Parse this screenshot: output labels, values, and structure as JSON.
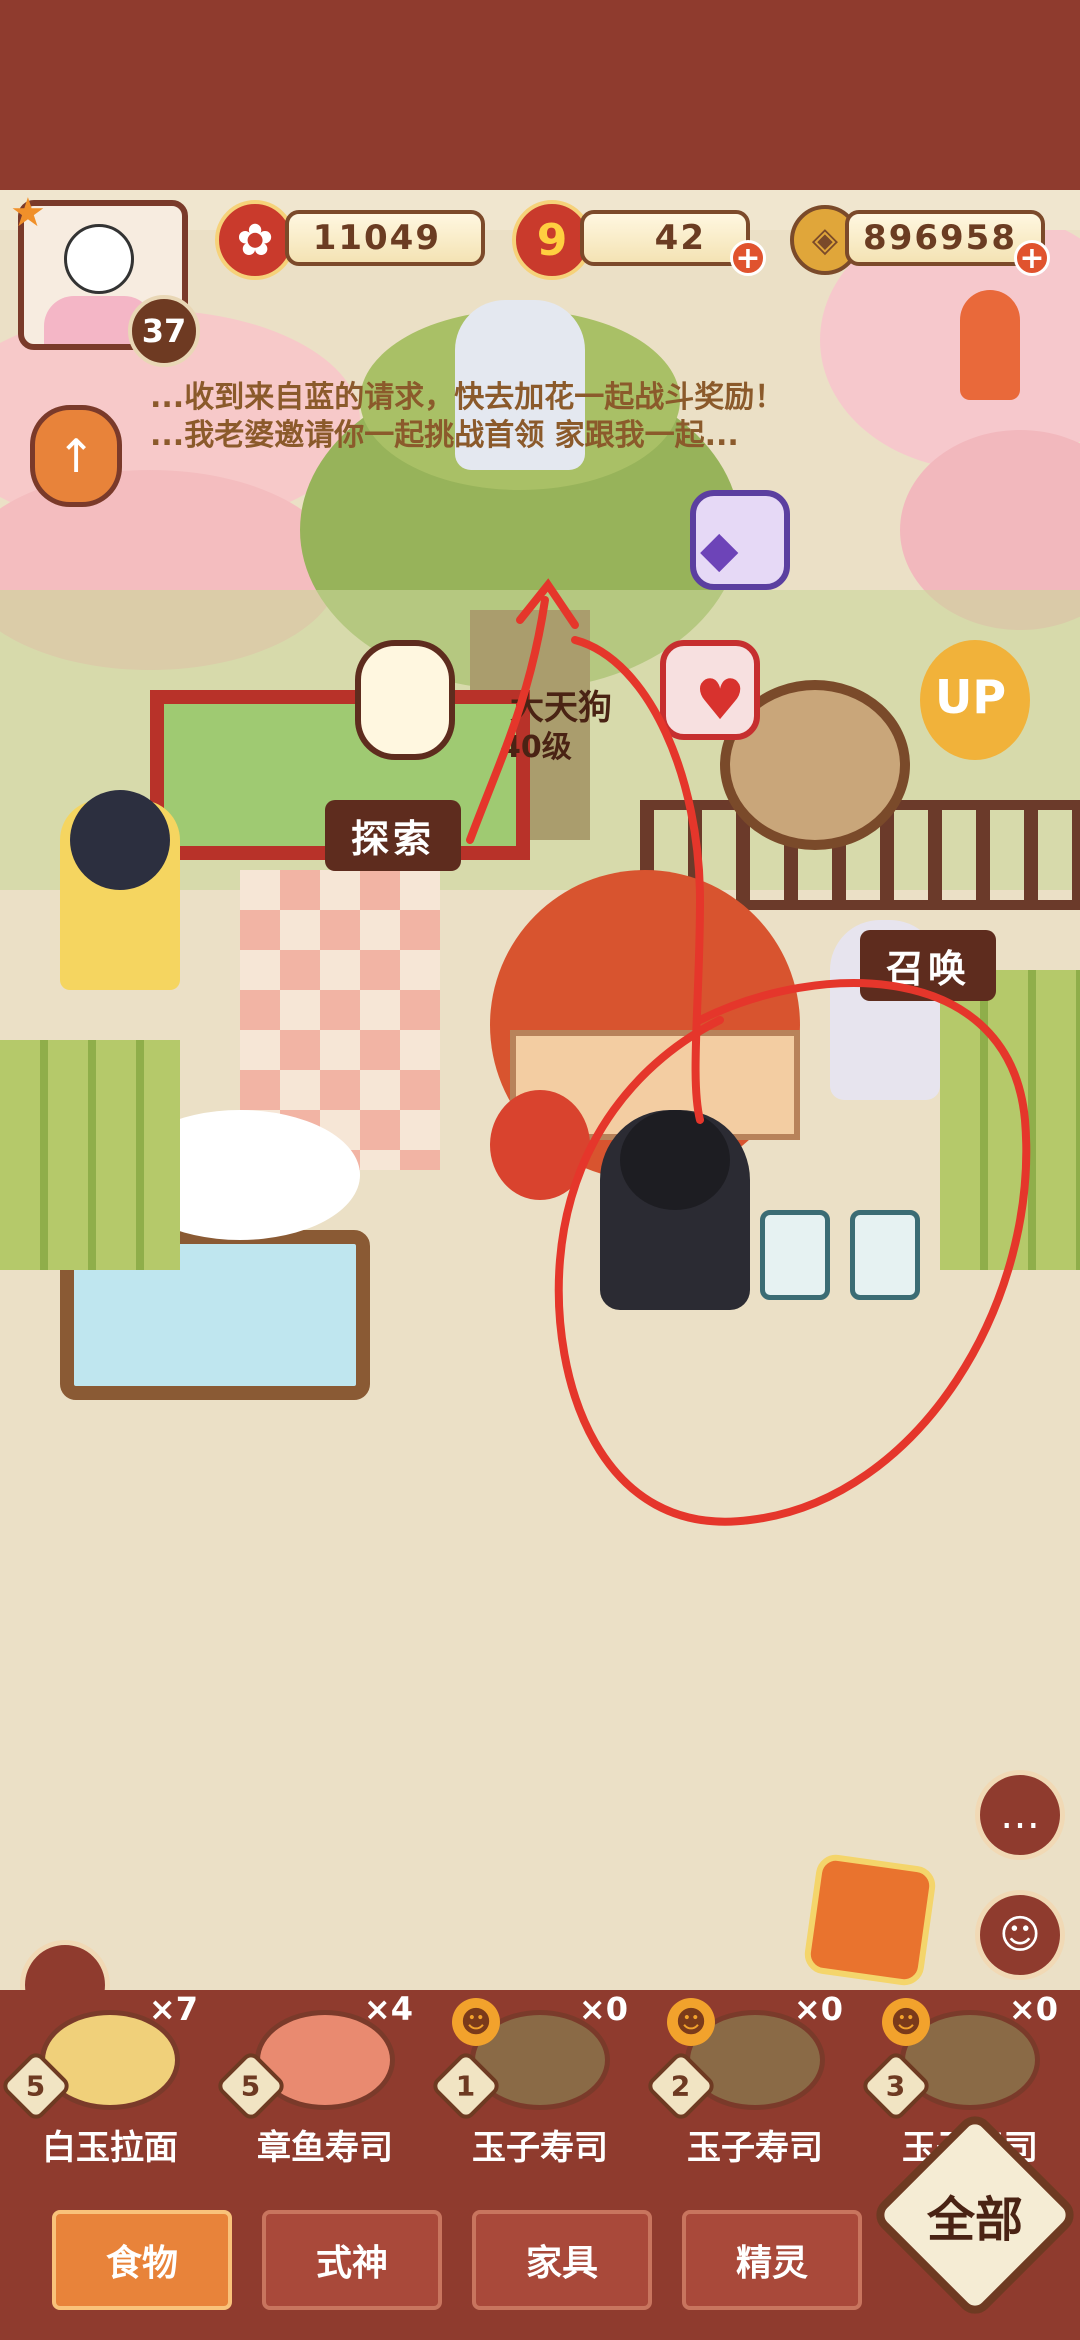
{
  "resources": {
    "stamina_value": "11049",
    "ticket_value": "42",
    "ticket_icon_label": "9",
    "coins_value": "896958"
  },
  "player": {
    "level": "37"
  },
  "marquee": {
    "line1": "...收到来自蓝的请求，快去加花一起战斗奖励！",
    "line2": "...我老婆邀请你一起挑战首领 家跟我一起..."
  },
  "map_labels": {
    "explore": "探索",
    "summon": "召唤",
    "boss_name": "大天狗",
    "boss_level": "40级",
    "up_balloon": "UP"
  },
  "food_items": [
    {
      "name": "白玉拉面",
      "count": "×7",
      "level": "5"
    },
    {
      "name": "章鱼寿司",
      "count": "×4",
      "level": "5"
    },
    {
      "name": "玉子寿司",
      "count": "×0",
      "level": "1"
    },
    {
      "name": "玉子寿司",
      "count": "×0",
      "level": "2"
    },
    {
      "name": "玉子寿司",
      "count": "×0",
      "level": "3"
    }
  ],
  "tabs": [
    "食物",
    "式神",
    "家具",
    "精灵"
  ],
  "all_button": "全部",
  "colors": {
    "wood": "#8f3b2e",
    "ink_red": "#e5362b",
    "accent_orange": "#e8833a"
  },
  "icons": {
    "stamina": "plum-blossom-icon",
    "ticket": "ticket-icon",
    "coins": "coin-icon",
    "chat": "chat-bubble-icon",
    "gift": "gift-bag-icon",
    "fish": "koi-streamer-icon"
  }
}
